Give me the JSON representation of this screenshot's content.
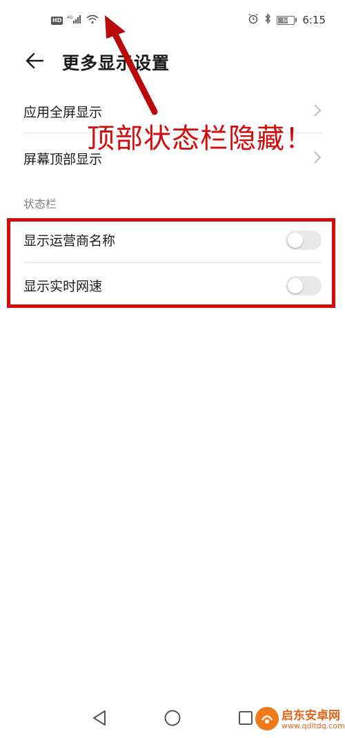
{
  "status_bar": {
    "left_badge": "HD",
    "network_type": "4G",
    "battery_level": "64",
    "battery_fraction": 0.64,
    "time": "6:15",
    "icons": [
      "hd-icon",
      "signal-icon",
      "wifi-icon",
      "alarm-icon",
      "bluetooth-icon",
      "battery-icon"
    ]
  },
  "header": {
    "title": "更多显示设置",
    "back_icon": "back-arrow-icon"
  },
  "list": {
    "items": [
      {
        "label": "应用全屏显示",
        "icon": "chevron-right-icon"
      },
      {
        "label": "屏幕顶部显示",
        "icon": "chevron-right-icon"
      }
    ]
  },
  "section": {
    "label": "状态栏"
  },
  "toggles": [
    {
      "label": "显示运营商名称",
      "on": false
    },
    {
      "label": "显示实时网速",
      "on": false
    }
  ],
  "annotation": {
    "text": "顶部状态栏隐藏！",
    "color": "#d40b0b"
  },
  "nav_bar": {
    "icons": [
      "back-triangle-icon",
      "home-circle-icon",
      "recents-square-icon"
    ]
  },
  "watermark": {
    "name": "启东安卓网",
    "url": "www.qdltdq.com"
  },
  "colors": {
    "accent_red": "#d40b0b",
    "watermark_orange": "#f07a1a"
  }
}
